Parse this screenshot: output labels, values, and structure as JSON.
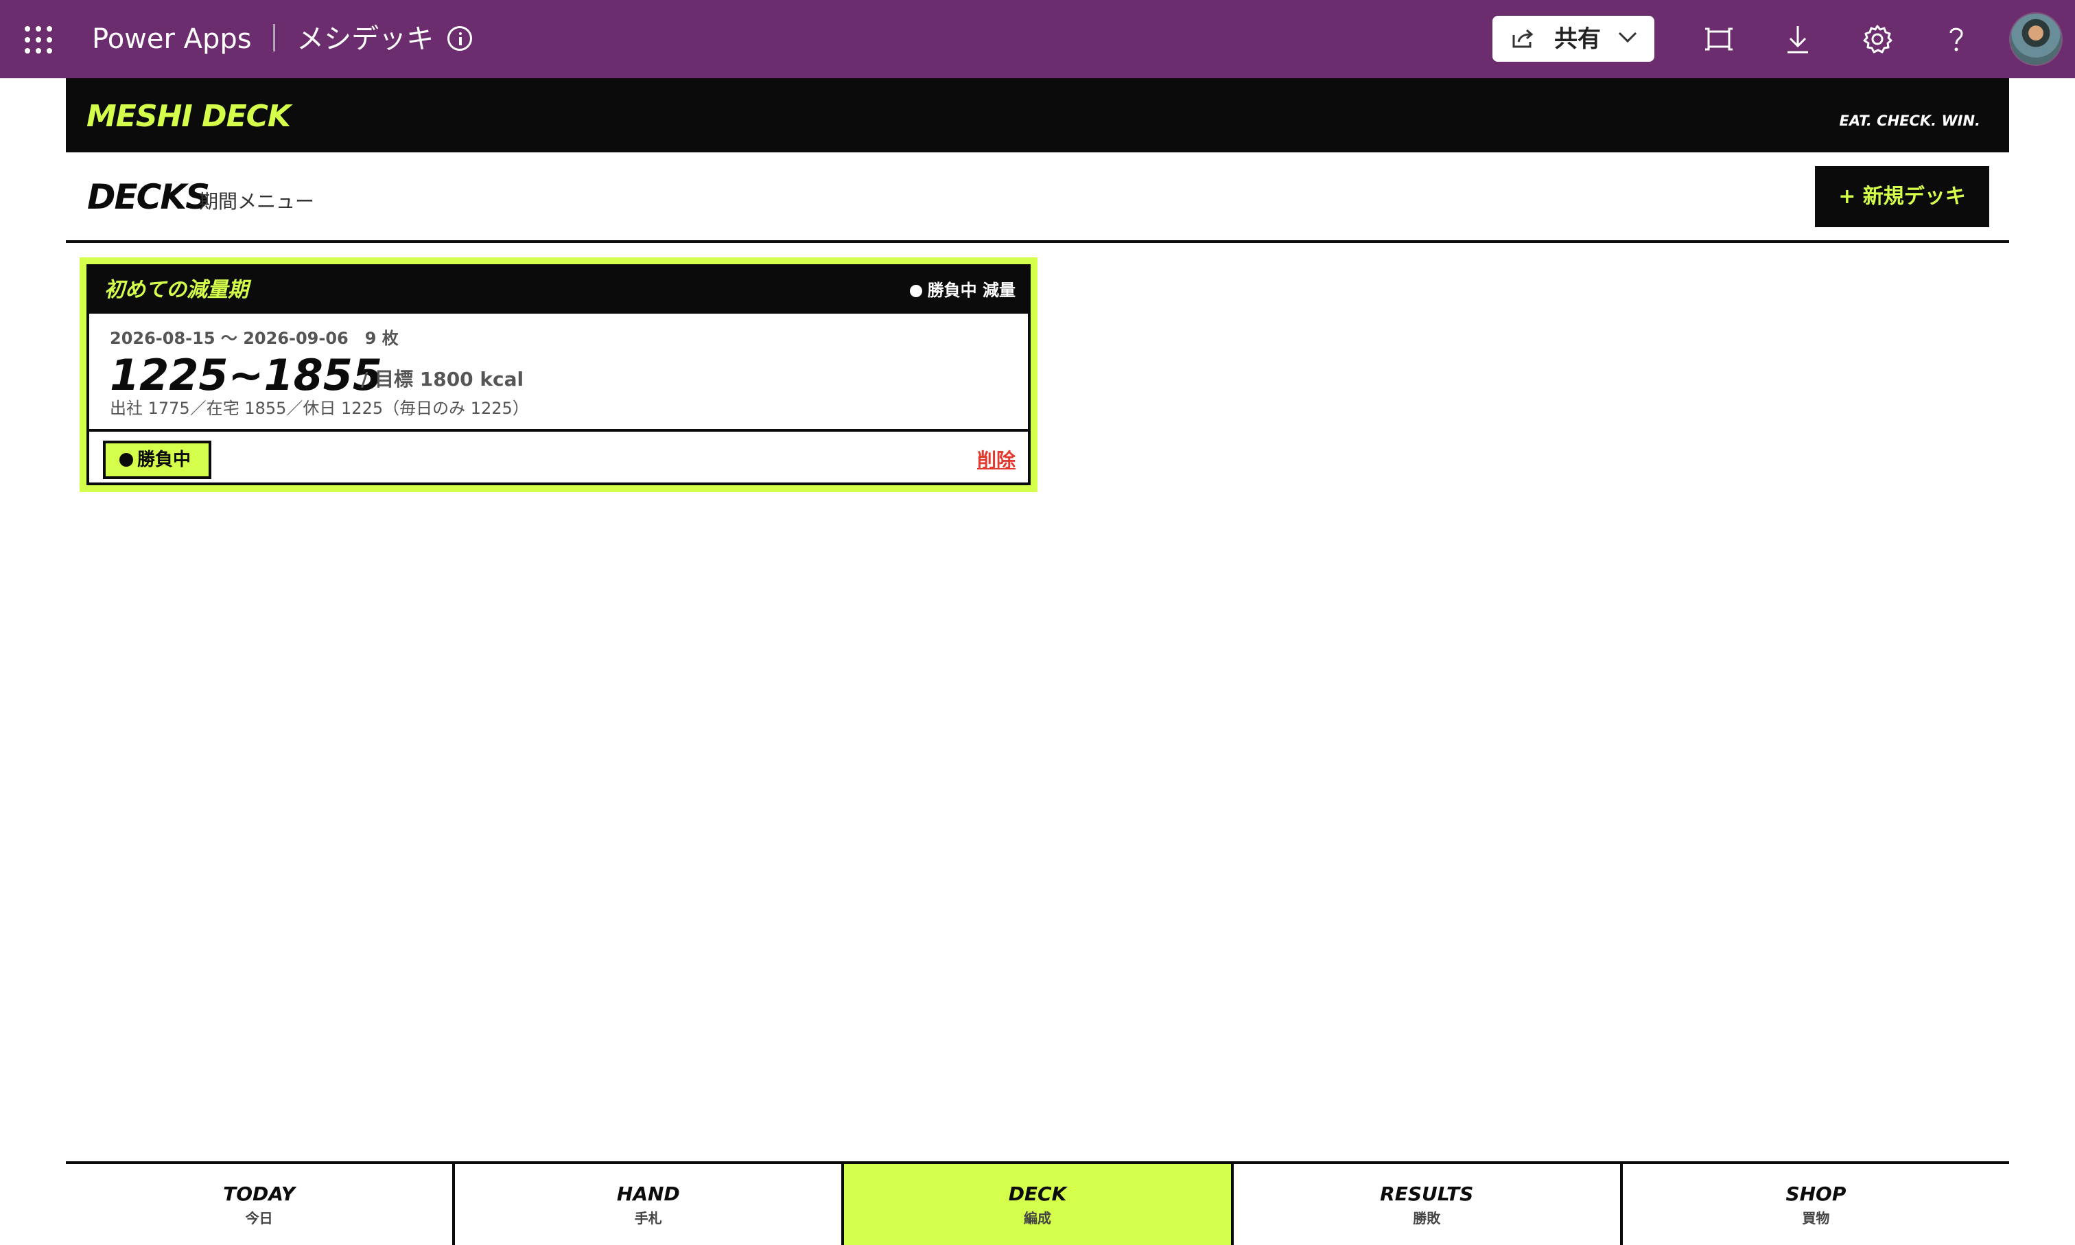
{
  "topbar": {
    "app_title": "Power Apps ｜ メシデッキ",
    "share_label": "共有",
    "icons": [
      "waffle-icon",
      "info-icon",
      "share-icon",
      "chevron-down-icon",
      "fit-screen-icon",
      "download-icon",
      "gear-icon",
      "help-icon",
      "avatar"
    ]
  },
  "app_header": {
    "logo": "MESHI DECK",
    "tagline": "EAT. CHECK. WIN."
  },
  "page": {
    "title": "DECKS",
    "subtitle": "期間メニュー",
    "new_deck_label": "+ 新規デッキ"
  },
  "deck_card": {
    "name": "初めての減量期",
    "status": "勝負中 減量",
    "dates": "2026-08-15 〜 2026-09-06　9 枚",
    "kcal_range": "1225~1855",
    "goal": "/ 目標 1800 kcal",
    "detail": "出社 1775／在宅 1855／休日 1225（毎日のみ 1225）",
    "badge": "勝負中",
    "delete_label": "削除"
  },
  "bottom_nav": {
    "items": [
      {
        "en": "TODAY",
        "ja": "今日"
      },
      {
        "en": "HAND",
        "ja": "手札"
      },
      {
        "en": "DECK",
        "ja": "編成"
      },
      {
        "en": "RESULTS",
        "ja": "勝敗"
      },
      {
        "en": "SHOP",
        "ja": "買物"
      }
    ],
    "active": "DECK"
  },
  "colors": {
    "purple": "#6b2d6d",
    "accent": "#d4ff4a",
    "ink": "#0b0b0b",
    "danger": "#e23a2e"
  }
}
